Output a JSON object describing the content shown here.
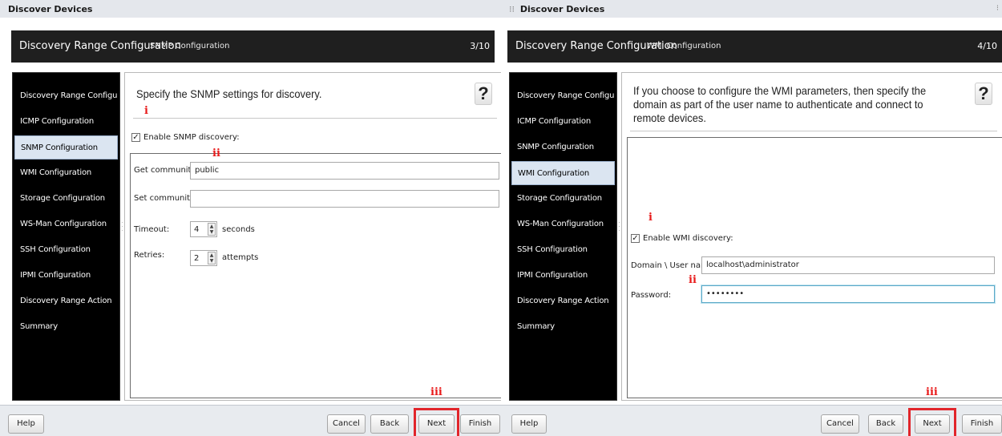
{
  "left": {
    "window_title": "Discover Devices",
    "header": {
      "main": "Discovery Range Configuration",
      "sub": "SNMP Configuration",
      "step": "3/10"
    },
    "nav": [
      "Discovery Range Configuration",
      "ICMP Configuration",
      "SNMP Configuration",
      "WMI Configuration",
      "Storage Configuration",
      "WS-Man Configuration",
      "SSH Configuration",
      "IPMI Configuration",
      "Discovery Range Action",
      "Summary"
    ],
    "selected_nav": "SNMP Configuration",
    "title": "Specify the SNMP settings for discovery.",
    "enable_label": "Enable SNMP discovery:",
    "enable_checked": true,
    "get_community_label": "Get community:",
    "get_community_value": "public",
    "set_community_label": "Set community:",
    "set_community_value": "",
    "timeout_label": "Timeout:",
    "timeout_value": "4",
    "timeout_unit": "seconds",
    "retries_label": "Retries:",
    "retries_value": "2",
    "retries_unit": "attempts",
    "markers": {
      "i": "i",
      "ii": "ii",
      "iii": "iii"
    },
    "buttons": {
      "help": "Help",
      "cancel": "Cancel",
      "back": "Back",
      "next": "Next",
      "finish": "Finish"
    }
  },
  "right": {
    "window_title": "Discover Devices",
    "header": {
      "main": "Discovery Range Configuration",
      "sub": "WMI Configuration",
      "step": "4/10"
    },
    "nav": [
      "Discovery Range Configuration",
      "ICMP Configuration",
      "SNMP Configuration",
      "WMI Configuration",
      "Storage Configuration",
      "WS-Man Configuration",
      "SSH Configuration",
      "IPMI Configuration",
      "Discovery Range Action",
      "Summary"
    ],
    "selected_nav": "WMI Configuration",
    "title": "If you choose to configure the WMI parameters, then specify the domain as part of the user name to authenticate and connect to remote devices.",
    "enable_label": "Enable WMI discovery:",
    "enable_checked": true,
    "user_label": "Domain \\ User name:",
    "user_value": "localhost\\administrator",
    "password_label": "Password:",
    "password_value": "••••••••",
    "markers": {
      "i": "i",
      "ii": "ii",
      "iii": "iii"
    },
    "buttons": {
      "help": "Help",
      "cancel": "Cancel",
      "back": "Back",
      "next": "Next",
      "finish": "Finish"
    }
  },
  "colors": {
    "highlight": "#e1252b",
    "marker": "#e81a1a",
    "header_bg": "#1f1f1f",
    "nav_bg": "#000000",
    "selected_nav": "#dbe5f1"
  }
}
